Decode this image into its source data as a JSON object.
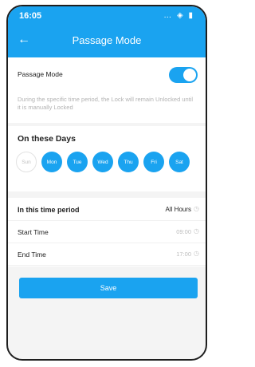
{
  "status": {
    "time": "16:05",
    "icons": "•• ◔ ▮"
  },
  "header": {
    "back_icon": "arrow-left-icon",
    "title": "Passage Mode"
  },
  "passage": {
    "label": "Passage Mode",
    "enabled": true,
    "description": "During the specific time period, the Lock will remain Unlocked until it is manually Locked"
  },
  "days": {
    "title": "On these Days",
    "items": [
      {
        "label": "Sun",
        "selected": false
      },
      {
        "label": "Mon",
        "selected": true
      },
      {
        "label": "Tue",
        "selected": true
      },
      {
        "label": "Wed",
        "selected": true
      },
      {
        "label": "Thu",
        "selected": true
      },
      {
        "label": "Fri",
        "selected": true
      },
      {
        "label": "Sat",
        "selected": true
      }
    ]
  },
  "time_period": {
    "label": "In this time period",
    "value": "All Hours",
    "start_label": "Start Time",
    "start_value": "09:00",
    "end_label": "End Time",
    "end_value": "17:00"
  },
  "save_label": "Save",
  "colors": {
    "accent": "#1aa3f0",
    "background": "#f4f4f4"
  }
}
